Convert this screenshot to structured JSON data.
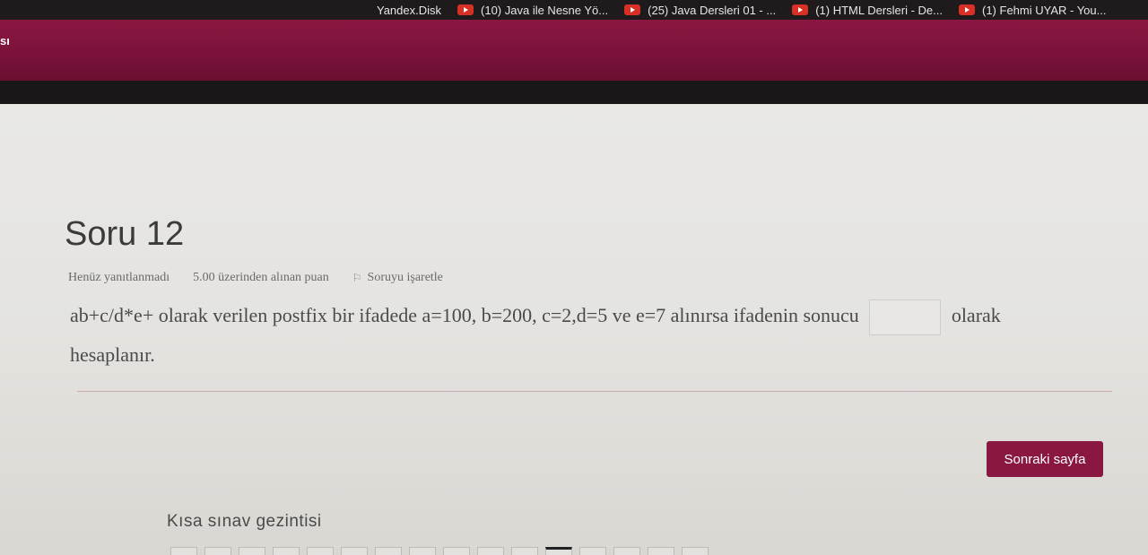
{
  "bookmarks": [
    {
      "label": "Yandex.Disk",
      "icon": "none"
    },
    {
      "label": "(10) Java ile Nesne Yö...",
      "icon": "youtube-icon"
    },
    {
      "label": "(25) Java Dersleri 01 - ...",
      "icon": "youtube-icon"
    },
    {
      "label": "(1) HTML Dersleri - De...",
      "icon": "youtube-icon"
    },
    {
      "label": "(1) Fehmi UYAR - You...",
      "icon": "youtube-icon"
    }
  ],
  "header": {
    "brand": "sı"
  },
  "question": {
    "title": "Soru 12",
    "status": "Henüz yanıtlanmadı",
    "points": "5.00 üzerinden alınan puan",
    "flag_label": "Soruyu işaretle",
    "text_before": "ab+c/d*e+ olarak verilen postfix bir ifadede a=100, b=200, c=2,d=5 ve e=7 alınırsa ifadenin sonucu",
    "answer_value": "",
    "text_after": "olarak hesaplanır."
  },
  "actions": {
    "next_label": "Sonraki sayfa"
  },
  "quiz_nav": {
    "title": "Kısa sınav gezintisi",
    "count": 16,
    "current": 12
  },
  "colors": {
    "brand": "#8a1742",
    "bookmark_bar": "#1f1a1c"
  }
}
